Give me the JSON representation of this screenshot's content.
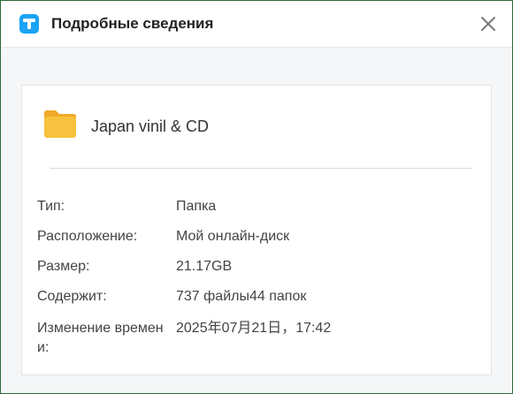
{
  "window": {
    "title": "Подробные сведения",
    "close_icon": "close-icon",
    "logo_icon": "app-logo-icon",
    "accent_color": "#1aa3f5",
    "border_color": "#2e6b3a"
  },
  "item": {
    "icon": "folder-icon",
    "icon_color": "#f7c23f",
    "name": "Japan vinil & CD"
  },
  "details": [
    {
      "label": "Тип:",
      "value": "Папка"
    },
    {
      "label": "Расположение:",
      "value": "Мой онлайн-диск"
    },
    {
      "label": "Размер:",
      "value": "21.17GB"
    },
    {
      "label": "Содержит:",
      "value": "737 файлы44 папок"
    },
    {
      "label": "Изменение времени:",
      "value": "2025年07月21日，17:42"
    }
  ]
}
